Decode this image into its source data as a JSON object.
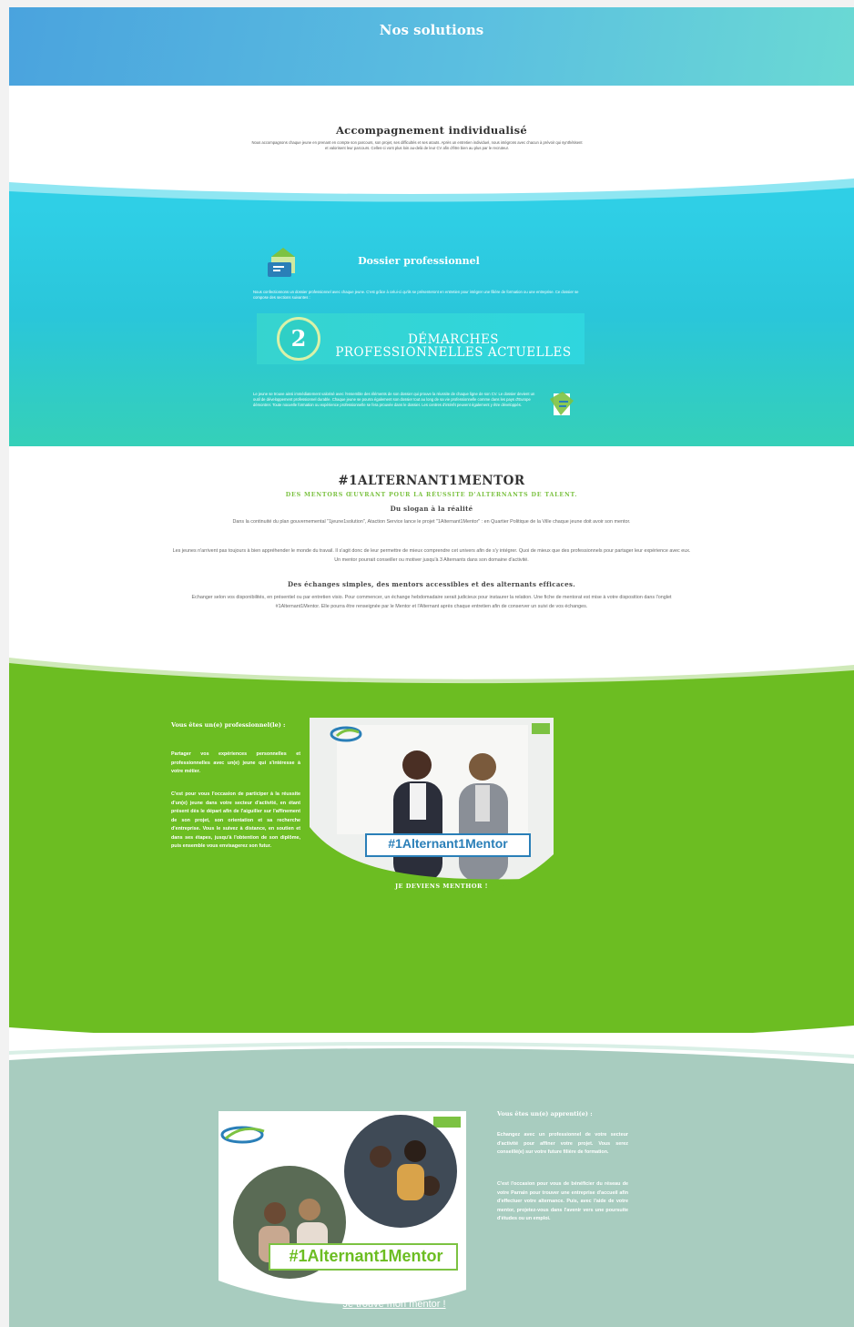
{
  "hero": {
    "title": "Nos solutions"
  },
  "individualise": {
    "title": "Accompagnement individualisé",
    "text": "Nous accompagnons chaque jeune en prenant en compte son parcours, son projet, ses difficultés et ses atouts. Après un entretien individuel, nous intégrons avec chacun à prévoir qui synthétisent et valorisent leur parcours. Celles-ci vont plus loin au-delà de leur CV afin d'être bien au plus par le recruteur."
  },
  "dossier": {
    "title": "Dossier professionnel",
    "text": "Nous confectionnons un dossier professionnel avec chaque jeune. C'est grâce à celui-ci qu'ils se présenteront en entretien pour intégrer une filière de formation ou une entreprise. Ce dossier se compose des sections suivantes :",
    "badge_number": "2",
    "badge_text": "DÉMARCHES PROFESSIONNELLES ACTUELLES",
    "text2": "Le jeune se trouve ainsi immédiatement valorisé avec l'ensemble des éléments de son dossier qui prouve la réussite de chaque ligne de son CV. Le dossier devient un outil de développement professionnel durable. Chaque jeune se pourra également son dossier tout au long de sa vie professionnelle comme dans les pays d'Europe démontrer. Toute nouvelle formation ou expérience professionnelle se fera prouvée dans le dossier. Les centres d'intérêt peuvent également y être développés.",
    "icon": "folder-icon",
    "icon2": "document-icon"
  },
  "alternant": {
    "title": "#1ALTERNANT1MENTOR",
    "subtitle": "DES MENTORS ŒUVRANT POUR LA RÉUSSITE D'ALTERNANTS DE TALENT.",
    "heading1": "Du slogan à la réalité",
    "p1": "Dans la continuité du plan gouvernemental \"1jeune1solution\", Ataction Service lance le projet \"1Alternant1Mentor\" : en Quartier Politique de la Ville chaque jeune doit avoir son mentor.",
    "p2": "Les jeunes n'arrivent pas toujours à bien appréhender le monde du travail. Il s'agit donc de leur permettre de mieux comprendre cet univers afin de s'y intégrer. Quoi de mieux que des professionnels pour partager leur expérience avec eux. Un mentor pourrait conseiller ou motiver jusqu'à 3 Alternants dans son domaine d'activité.",
    "heading2": "Des échanges simples, des mentors accessibles et des alternants efficaces.",
    "p3": "Echanger selon vos disponibilités, en présentiel ou par entretien visio. Pour commencer, un échange hebdomadaire serait judicieux pour instaurer la relation. Une fiche de mentorat est mise à votre disposition dans l'onglet #1Alternant1Mentor. Elle pourra être renseignée par le Mentor et l'Alternant après chaque entretien afin de conserver un suivi de vos échanges."
  },
  "professionnel": {
    "heading": "Vous êtes un(e) professionnel(le) :",
    "p1": "Partager vos expériences personnelles et professionnelles avec un(e) jeune qui s'intéresse à votre métier.",
    "p2": "C'est pour vous l'occasion de participer à la réussite d'un(e) jeune dans votre secteur d'activité, en étant présent dès le départ afin de l'aiguiller sur l'affinement de son projet, son orientation et sa recherche d'entreprise. Vous le suivez à distance, en soutien et dans ses étapes, jusqu'à l'obtention de son diplôme, puis ensemble vous envisagerez son futur.",
    "cta": "JE DEVIENS MENTHOR !",
    "image_hashtag": "#1Alternant1Mentor"
  },
  "apprenti": {
    "heading": "Vous êtes un(e) apprenti(e) :",
    "p1": "Echangez avec un professionnel de votre secteur d'activité pour affiner votre projet. Vous serez conseillé(e) sur votre future filière de formation.",
    "p2": "C'est l'occasion pour vous de bénéficier du réseau de votre Parrain pour trouver une entreprise d'accueil afin d'effectuer votre alternance. Puis, avec l'aide de votre mentor, projetez-vous dans l'avenir vers une poursuite d'études ou un emploi.",
    "image_hashtag": "#1Alternant1Mentor",
    "image_cta": "Je trouve mon mentor !"
  },
  "colors": {
    "hero_start": "#4aa3de",
    "hero_end": "#6ad9d4",
    "teal": "#2ac6da",
    "green": "#6cbd22",
    "sage": "#a8ccbf",
    "accent_green": "#7cc242"
  }
}
